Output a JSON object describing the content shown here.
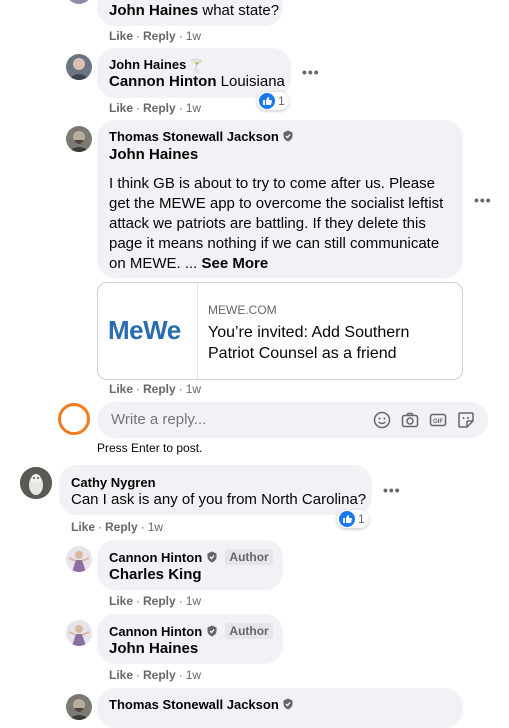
{
  "comments": [
    {
      "author": "John Haines",
      "text": "what state?",
      "like": "Like",
      "reply": "Reply",
      "age": "1w"
    },
    {
      "author": "John Haines",
      "tag": "Cannon Hinton",
      "text": "Louisiana",
      "like": "Like",
      "reply": "Reply",
      "age": "1w",
      "reactions": "1"
    },
    {
      "author": "Thomas Stonewall Jackson",
      "tag": "John Haines",
      "lines": [
        "I think GB is about to try to come after us. Please",
        "get the MEWE app to overcome the socialist leftist",
        "attack we patriots are battling. If they delete this",
        "page it means nothing if we can still communicate",
        "on MEWE. ... "
      ],
      "see_more": "See More",
      "link": {
        "logo": "MeWe",
        "domain": "MEWE.COM",
        "title_lines": [
          "You’re invited: Add Southern",
          "Patriot Counsel as a friend"
        ]
      },
      "like": "Like",
      "reply": "Reply",
      "age": "1w"
    },
    {
      "author": "Cathy Nygren",
      "text": "Can I ask is any of you from North Carolina?",
      "like": "Like",
      "reply": "Reply",
      "age": "1w",
      "reactions": "1"
    },
    {
      "author": "Cannon Hinton",
      "author_badge": "Author",
      "tag": "Charles King",
      "like": "Like",
      "reply": "Reply",
      "age": "1w"
    },
    {
      "author": "Cannon Hinton",
      "author_badge": "Author",
      "tag": "John Haines",
      "like": "Like",
      "reply": "Reply",
      "age": "1w"
    },
    {
      "author": "Thomas Stonewall Jackson"
    }
  ],
  "reply_input": {
    "placeholder": "Write a reply...",
    "hint": "Press Enter to post."
  },
  "colors": {
    "bubble": "#f0f2f5",
    "meta": "#65676b",
    "like_blue": "#1877f2",
    "highlight_ring": "#f07c1f",
    "mewe_blue": "#2b6cb0"
  },
  "icons": [
    "emoji-icon",
    "camera-icon",
    "gif-icon",
    "sticker-icon",
    "more-options-icon",
    "like-reaction-icon",
    "verified-badge-icon"
  ]
}
